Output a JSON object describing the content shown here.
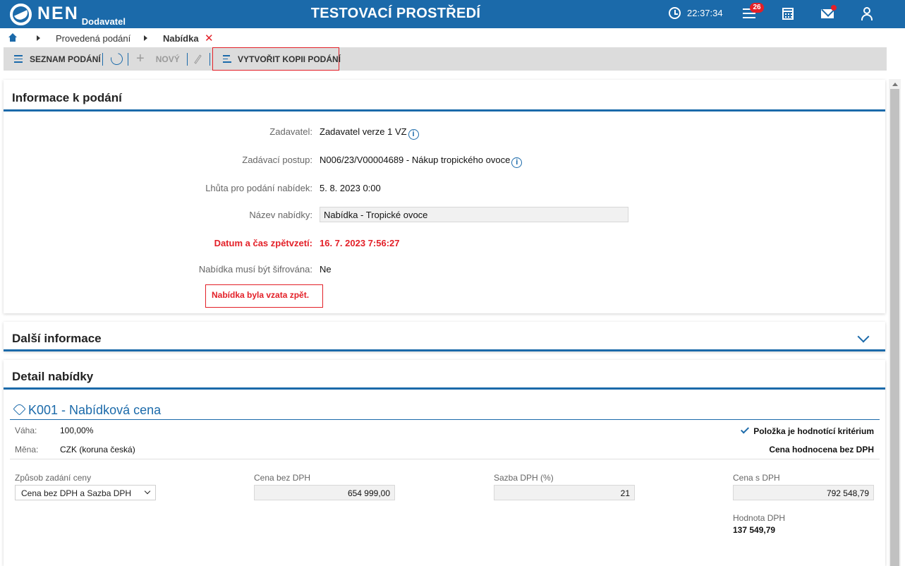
{
  "header": {
    "logo_text": "NEN",
    "logo_sub": "Dodavatel",
    "env_title": "TESTOVACÍ PROSTŘEDÍ",
    "clock": "22:37:34",
    "notifications_count": "26",
    "colors": {
      "brand": "#1b6aaa",
      "alert": "#e32028"
    }
  },
  "breadcrumb": {
    "items": [
      "Provedená podání",
      "Nabídka"
    ]
  },
  "toolbar": {
    "list_label": "SEZNAM PODÁNÍ",
    "new_label": "NOVÝ",
    "copy_label": "VYTVOŘIT KOPII PODÁNÍ"
  },
  "info_panel": {
    "title": "Informace k podání",
    "rows": [
      {
        "label": "Zadavatel:",
        "value": "Zadavatel verze 1 VZ"
      },
      {
        "label": "Zadávací postup:",
        "value": "N006/23/V00004689 - Nákup tropického ovoce"
      },
      {
        "label": "Lhůta pro podání nabídek:",
        "value": "5. 8. 2023 0:00"
      },
      {
        "label": "Název nabídky:",
        "value": "Nabídka - Tropické ovoce"
      },
      {
        "label": "Datum a čas zpětvzetí:",
        "value": "16. 7. 2023 7:56:27"
      },
      {
        "label": "Nabídka musí být šifrována:",
        "value": "Ne"
      }
    ],
    "warning": "Nabídka byla vzata zpět."
  },
  "more_panel": {
    "title": "Další informace"
  },
  "detail_panel": {
    "title": "Detail nabídky",
    "criterion": {
      "title": "K001 - Nabídková cena",
      "weight_label": "Váha:",
      "weight_value": "100,00%",
      "currency_label": "Měna:",
      "currency_value": "CZK (koruna česká)",
      "criterion_flag": "Položka je hodnotící kritérium",
      "evaluation_note": "Cena hodnocena bez DPH"
    },
    "fields": {
      "price_mode_label": "Způsob zadání ceny",
      "price_mode_value": "Cena bez DPH a Sazba DPH",
      "price_no_vat_label": "Cena bez DPH",
      "price_no_vat_value": "654 999,00",
      "vat_rate_label": "Sazba DPH (%)",
      "vat_rate_value": "21",
      "price_with_vat_label": "Cena s DPH",
      "price_with_vat_value": "792 548,79",
      "vat_amount_label": "Hodnota DPH",
      "vat_amount_value": "137 549,79"
    }
  }
}
